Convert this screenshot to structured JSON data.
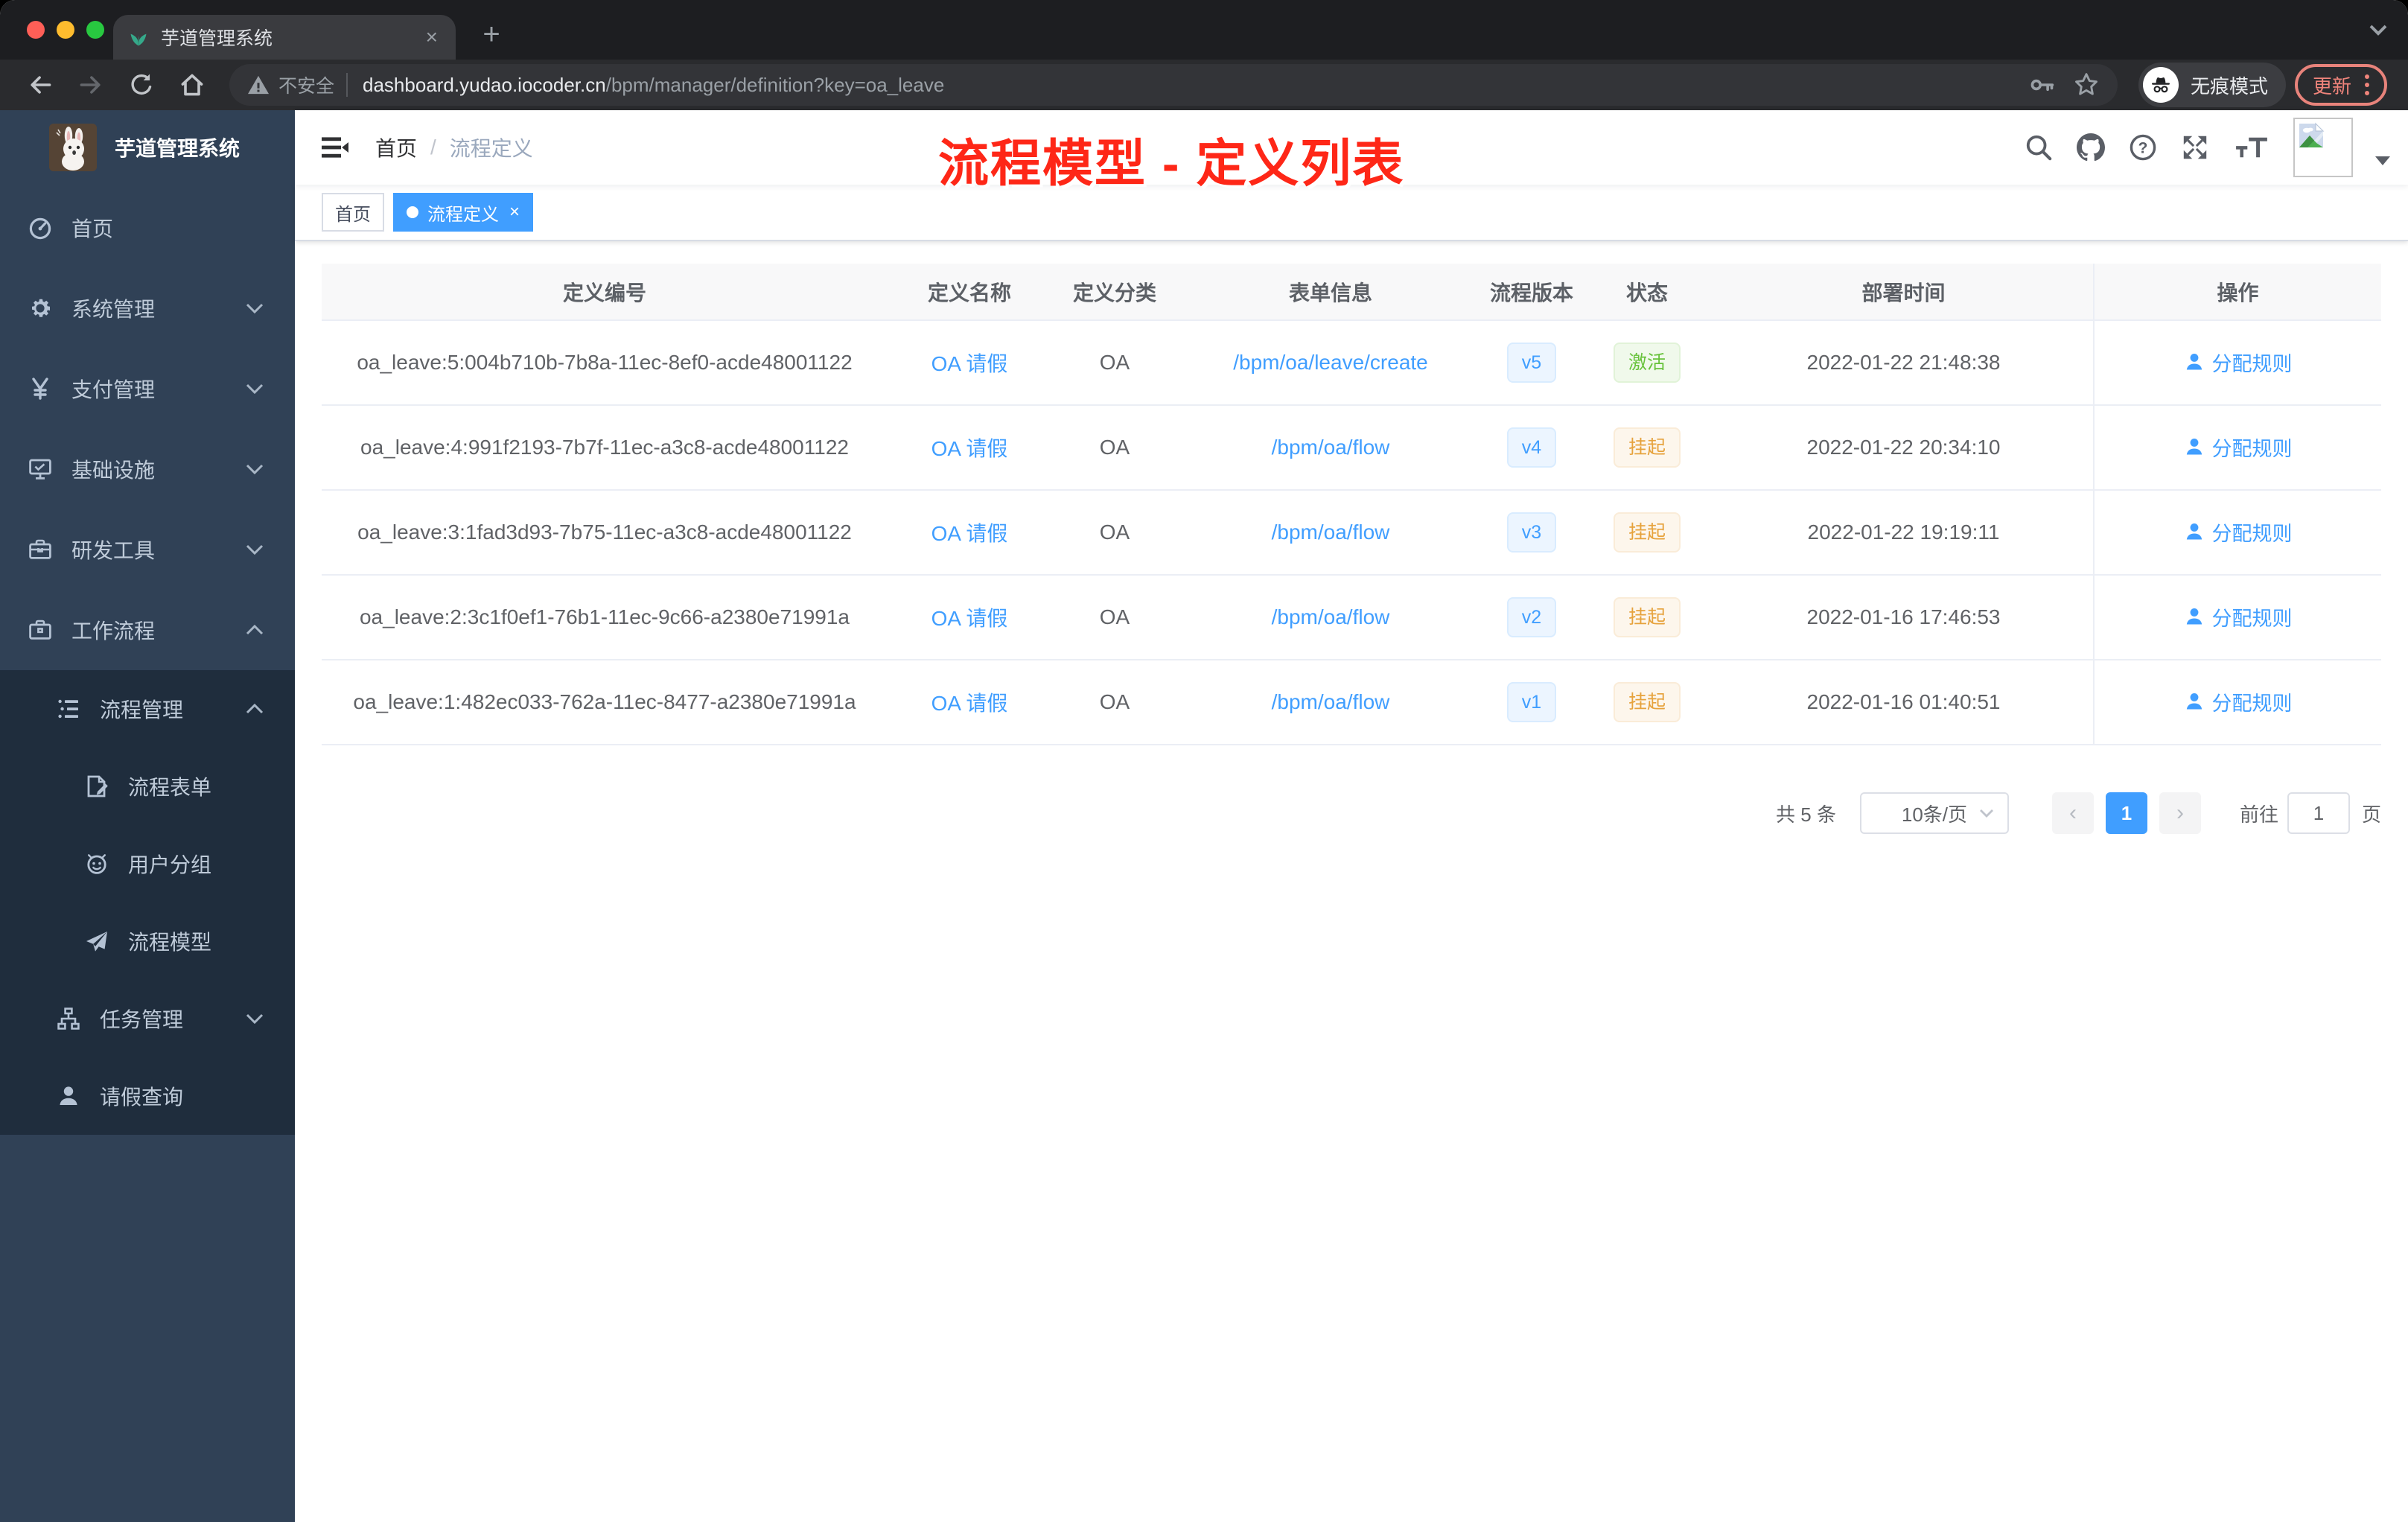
{
  "browser": {
    "tab_title": "芋道管理系统",
    "tab_close": "×",
    "new_tab": "+",
    "security_label": "不安全",
    "url_host": "dashboard.yudao.iocoder.cn",
    "url_path": "/bpm/manager/definition?key=oa_leave",
    "incognito_label": "无痕模式",
    "update_label": "更新",
    "toolbar_icons": [
      "back-icon",
      "forward-icon",
      "reload-icon",
      "home-icon",
      "warning-icon",
      "key-icon",
      "star-icon",
      "incognito-icon",
      "kebab-menu-icon"
    ]
  },
  "sidebar": {
    "logo_title": "芋道管理系统",
    "items": [
      {
        "name": "home",
        "label": "首页",
        "icon": "dashboard-icon",
        "level": 1,
        "sub": false,
        "chevron": ""
      },
      {
        "name": "system-management",
        "label": "系统管理",
        "icon": "gear-icon",
        "level": 1,
        "sub": false,
        "chevron": "down"
      },
      {
        "name": "payment-management",
        "label": "支付管理",
        "icon": "yen-icon",
        "level": 1,
        "sub": false,
        "chevron": "down"
      },
      {
        "name": "infrastructure",
        "label": "基础设施",
        "icon": "monitor-icon",
        "level": 1,
        "sub": false,
        "chevron": "down"
      },
      {
        "name": "dev-tools",
        "label": "研发工具",
        "icon": "toolbox-icon",
        "level": 1,
        "sub": false,
        "chevron": "down"
      },
      {
        "name": "workflow",
        "label": "工作流程",
        "icon": "briefcase-icon",
        "level": 1,
        "sub": false,
        "chevron": "up"
      },
      {
        "name": "process-management",
        "label": "流程管理",
        "icon": "tree-list-icon",
        "level": 2,
        "sub": true,
        "chevron": "up"
      },
      {
        "name": "process-form",
        "label": "流程表单",
        "icon": "form-icon",
        "level": 3,
        "sub": true,
        "chevron": ""
      },
      {
        "name": "user-group",
        "label": "用户分组",
        "icon": "people-icon",
        "level": 3,
        "sub": true,
        "chevron": ""
      },
      {
        "name": "process-model",
        "label": "流程模型",
        "icon": "send-icon",
        "level": 3,
        "sub": true,
        "chevron": ""
      },
      {
        "name": "task-management",
        "label": "任务管理",
        "icon": "task-tree-icon",
        "level": 2,
        "sub": true,
        "chevron": "down"
      },
      {
        "name": "leave-query",
        "label": "请假查询",
        "icon": "user-icon",
        "level": 2,
        "sub": true,
        "chevron": ""
      }
    ]
  },
  "header": {
    "breadcrumb": {
      "home": "首页",
      "separator": "/",
      "current": "流程定义"
    },
    "annotation": "流程模型 - 定义列表",
    "icons": [
      "search-icon",
      "github-icon",
      "help-icon",
      "fullscreen-icon",
      "font-size-icon",
      "avatar-broken-image",
      "dropdown-caret-icon"
    ]
  },
  "tags": {
    "home": "首页",
    "active": "流程定义",
    "active_close": "×"
  },
  "table": {
    "headers": [
      "定义编号",
      "定义名称",
      "定义分类",
      "表单信息",
      "流程版本",
      "状态",
      "部署时间",
      "操作"
    ],
    "rows": [
      {
        "id": "oa_leave:5:004b710b-7b8a-11ec-8ef0-acde48001122",
        "name": "OA 请假",
        "category": "OA",
        "form": "/bpm/oa/leave/create",
        "version": "v5",
        "status": {
          "label": "激活",
          "type": "success"
        },
        "deployed": "2022-01-22 21:48:38",
        "action": "分配规则"
      },
      {
        "id": "oa_leave:4:991f2193-7b7f-11ec-a3c8-acde48001122",
        "name": "OA 请假",
        "category": "OA",
        "form": "/bpm/oa/flow",
        "version": "v4",
        "status": {
          "label": "挂起",
          "type": "warning"
        },
        "deployed": "2022-01-22 20:34:10",
        "action": "分配规则"
      },
      {
        "id": "oa_leave:3:1fad3d93-7b75-11ec-a3c8-acde48001122",
        "name": "OA 请假",
        "category": "OA",
        "form": "/bpm/oa/flow",
        "version": "v3",
        "status": {
          "label": "挂起",
          "type": "warning"
        },
        "deployed": "2022-01-22 19:19:11",
        "action": "分配规则"
      },
      {
        "id": "oa_leave:2:3c1f0ef1-76b1-11ec-9c66-a2380e71991a",
        "name": "OA 请假",
        "category": "OA",
        "form": "/bpm/oa/flow",
        "version": "v2",
        "status": {
          "label": "挂起",
          "type": "warning"
        },
        "deployed": "2022-01-16 17:46:53",
        "action": "分配规则"
      },
      {
        "id": "oa_leave:1:482ec033-762a-11ec-8477-a2380e71991a",
        "name": "OA 请假",
        "category": "OA",
        "form": "/bpm/oa/flow",
        "version": "v1",
        "status": {
          "label": "挂起",
          "type": "warning"
        },
        "deployed": "2022-01-16 01:40:51",
        "action": "分配规则"
      }
    ]
  },
  "pagination": {
    "total": "共 5 条",
    "page_size": "10条/页",
    "prev": "‹",
    "current_page": "1",
    "next": "›",
    "goto_label": "前往",
    "goto_value": "1",
    "unit": "页"
  },
  "colors": {
    "accent": "#409eff",
    "success": "#67c23a",
    "warning": "#e6a23c",
    "annotation_red": "#fe2717",
    "sidebar_bg": "#304156",
    "submenu_bg": "#1f2d3d"
  }
}
